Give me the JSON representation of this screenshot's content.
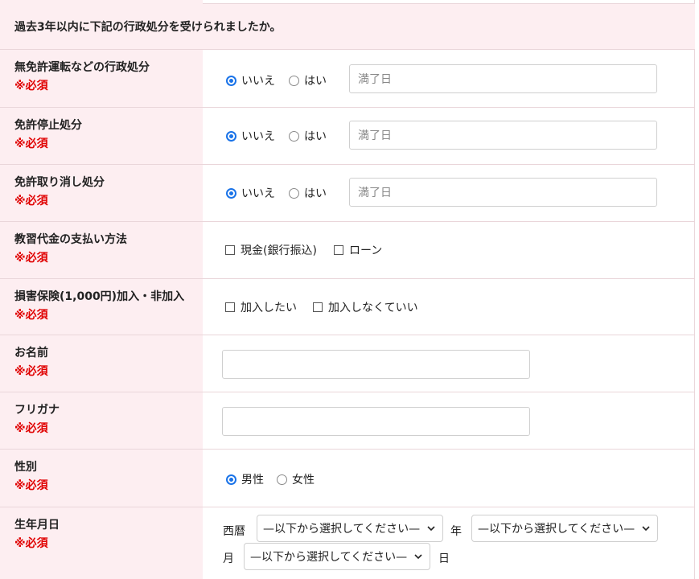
{
  "notice": "過去3年以内に下記の行政処分を受けられましたか。",
  "required": "※必須",
  "violation_rows": [
    {
      "label": "無免許運転などの行政処分",
      "no": "いいえ",
      "yes": "はい",
      "placeholder": "満了日"
    },
    {
      "label": "免許停止処分",
      "no": "いいえ",
      "yes": "はい",
      "placeholder": "満了日"
    },
    {
      "label": "免許取り消し処分",
      "no": "いいえ",
      "yes": "はい",
      "placeholder": "満了日"
    }
  ],
  "payment": {
    "label": "教習代金の支払い方法",
    "options": [
      "現金(銀行振込)",
      "ローン"
    ]
  },
  "insurance": {
    "label": "損害保険(1,000円)加入・非加入",
    "options": [
      "加入したい",
      "加入しなくていい"
    ]
  },
  "name": {
    "label": "お名前",
    "value": ""
  },
  "furigana": {
    "label": "フリガナ",
    "value": ""
  },
  "gender": {
    "label": "性別",
    "options": [
      "男性",
      "女性"
    ],
    "selected": "男性"
  },
  "birthdate": {
    "label": "生年月日",
    "era": "西暦",
    "year_suffix": "年",
    "month_suffix": "月",
    "day_suffix": "日",
    "select_placeholder": "—以下から選択してください—"
  },
  "colors": {
    "label_bg": "#fdeef1",
    "required": "#e00000",
    "accent": "#1a73e8",
    "border": "#ead6da"
  }
}
